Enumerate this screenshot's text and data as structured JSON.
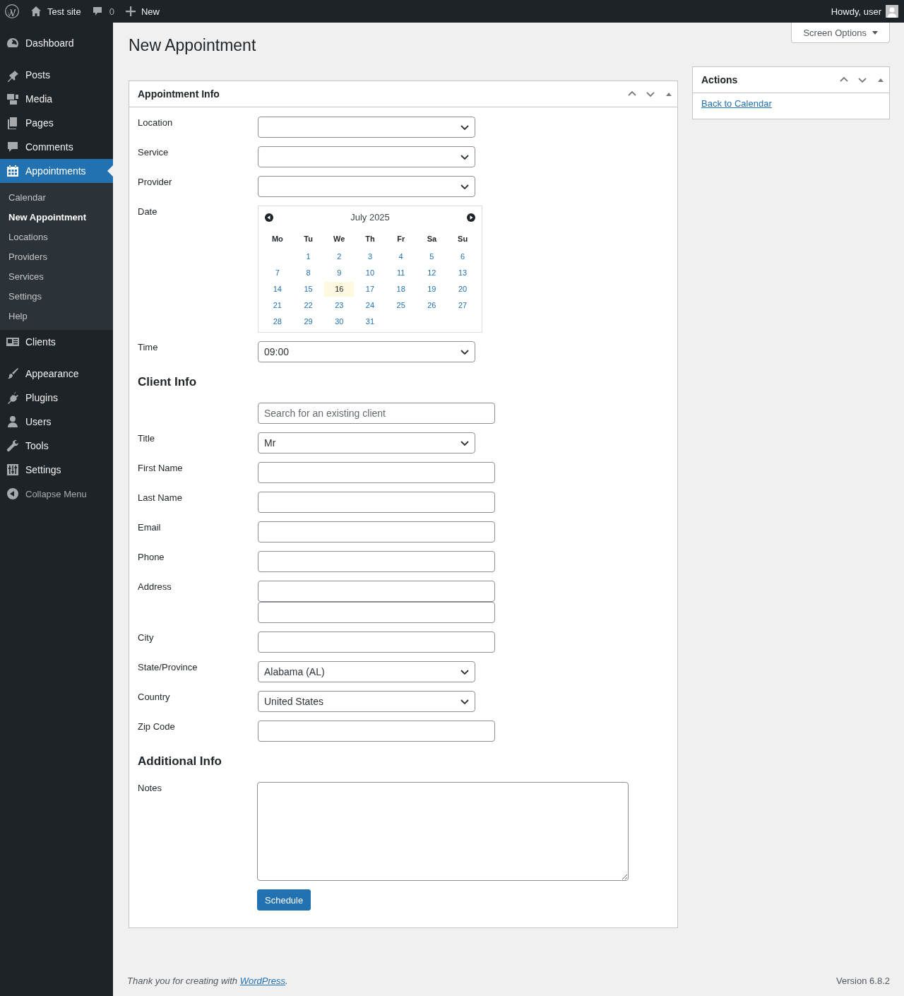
{
  "admin_bar": {
    "site_name": "Test site",
    "comments_count": "0",
    "new_label": "New",
    "greeting": "Howdy, user"
  },
  "sidebar": {
    "groups": [
      [
        {
          "label": "Dashboard",
          "selected": false
        }
      ],
      [
        {
          "label": "Posts",
          "selected": false
        },
        {
          "label": "Media",
          "selected": false
        },
        {
          "label": "Pages",
          "selected": false
        },
        {
          "label": "Comments",
          "selected": false
        },
        {
          "label": "Appointments",
          "selected": true,
          "children": [
            {
              "label": "Calendar",
              "selected": false
            },
            {
              "label": "New Appointment",
              "selected": true
            },
            {
              "label": "Locations",
              "selected": false
            },
            {
              "label": "Providers",
              "selected": false
            },
            {
              "label": "Services",
              "selected": false
            },
            {
              "label": "Settings",
              "selected": false
            },
            {
              "label": "Help",
              "selected": false
            }
          ]
        },
        {
          "label": "Clients",
          "selected": false
        }
      ],
      [
        {
          "label": "Appearance",
          "selected": false
        },
        {
          "label": "Plugins",
          "selected": false
        },
        {
          "label": "Users",
          "selected": false
        },
        {
          "label": "Tools",
          "selected": false
        },
        {
          "label": "Settings",
          "selected": false
        }
      ]
    ],
    "collapse": {
      "label": "Collapse Menu"
    }
  },
  "page": {
    "title": "New Appointment",
    "screen_options": "Screen Options"
  },
  "main_box": {
    "title": "Appointment Info",
    "rows": [
      {
        "kind": "select",
        "label": "Location"
      },
      {
        "kind": "select",
        "label": "Service"
      },
      {
        "kind": "select",
        "label": "Provider"
      },
      {
        "kind": "calendar",
        "label": "Date",
        "month": "July 2025",
        "weekdays": [
          "Mo",
          "Tu",
          "We",
          "Th",
          "Fr",
          "Sa",
          "Su"
        ],
        "weeks": [
          {
            "kind": "padded_start",
            "days": [
              {
                "day": "1",
                "today": false
              },
              {
                "day": "2",
                "today": false
              },
              {
                "day": "3",
                "today": false
              },
              {
                "day": "4",
                "today": false
              },
              {
                "day": "5",
                "today": false
              },
              {
                "day": "6",
                "today": false
              }
            ]
          },
          {
            "days": [
              {
                "day": "7",
                "today": false
              },
              {
                "day": "8",
                "today": false
              },
              {
                "day": "9",
                "today": false
              },
              {
                "day": "10",
                "today": false
              },
              {
                "day": "11",
                "today": false
              },
              {
                "day": "12",
                "today": false
              },
              {
                "day": "13",
                "today": false
              }
            ]
          },
          {
            "days": [
              {
                "day": "14",
                "today": false
              },
              {
                "day": "15",
                "today": false
              },
              {
                "day": "16",
                "today": true
              },
              {
                "day": "17",
                "today": false
              },
              {
                "day": "18",
                "today": false
              },
              {
                "day": "19",
                "today": false
              },
              {
                "day": "20",
                "today": false
              }
            ]
          },
          {
            "days": [
              {
                "day": "21",
                "today": false
              },
              {
                "day": "22",
                "today": false
              },
              {
                "day": "23",
                "today": false
              },
              {
                "day": "24",
                "today": false
              },
              {
                "day": "25",
                "today": false
              },
              {
                "day": "26",
                "today": false
              },
              {
                "day": "27",
                "today": false
              }
            ]
          },
          {
            "kind": "padded_end",
            "days": [
              {
                "day": "28",
                "today": false
              },
              {
                "day": "29",
                "today": false
              },
              {
                "day": "30",
                "today": false
              },
              {
                "day": "31",
                "today": false
              }
            ]
          }
        ]
      },
      {
        "kind": "select",
        "label": "Time",
        "value": "09:00"
      },
      {
        "kind": "heading",
        "text": "Client Info"
      },
      {
        "kind": "input",
        "placeholder": "Search for an existing client"
      },
      {
        "kind": "select",
        "label": "Title",
        "value": "Mr"
      },
      {
        "kind": "input",
        "label": "First Name"
      },
      {
        "kind": "input",
        "label": "Last Name"
      },
      {
        "kind": "input",
        "label": "Email"
      },
      {
        "kind": "input",
        "label": "Phone"
      },
      {
        "kind": "double_input",
        "label": "Address"
      },
      {
        "kind": "input",
        "label": "City"
      },
      {
        "kind": "select",
        "label": "State/Province",
        "value": "Alabama (AL)"
      },
      {
        "kind": "select",
        "label": "Country",
        "value": "United States"
      },
      {
        "kind": "input",
        "label": "Zip Code"
      },
      {
        "kind": "heading",
        "text": "Additional Info"
      },
      {
        "kind": "textarea",
        "label": "Notes"
      },
      {
        "kind": "button",
        "text": "Schedule"
      }
    ]
  },
  "actions_box": {
    "title": "Actions",
    "link": "Back to Calendar"
  },
  "footer": {
    "text_before": "Thank you for creating with ",
    "link": "WordPress",
    "text_after": ".",
    "version": "Version 6.8.2"
  }
}
